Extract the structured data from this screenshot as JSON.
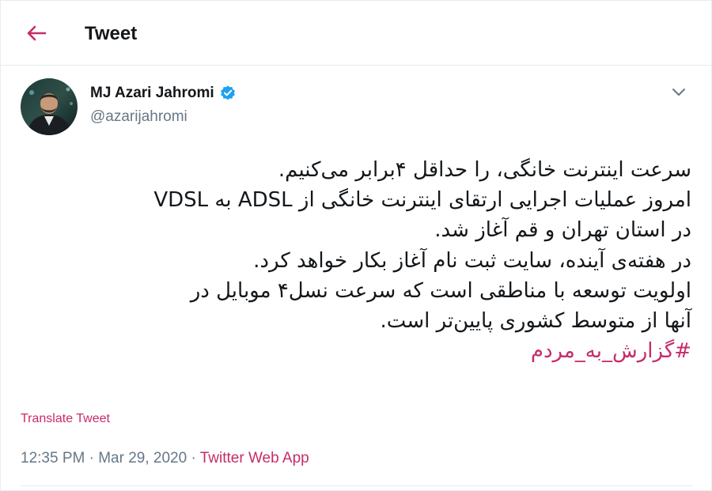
{
  "header": {
    "back_icon": "arrow-left-icon",
    "title": "Tweet"
  },
  "tweet": {
    "author": {
      "name": "MJ Azari Jahromi",
      "handle": "@azarijahromi",
      "verified": true,
      "verified_icon": "verified-badge-icon"
    },
    "menu_icon": "chevron-down-icon",
    "lines": [
      "سرعت اینترنت خانگی، را حداقل ۴برابر می‌کنیم.",
      "امروز عملیات اجرایی ارتقای اینترنت خانگی از ADSL به VDSL",
      " در استان تهران و قم آغاز شد.",
      "در هفته‌ی آینده، سایت ثبت نام آغاز بکار خواهد کرد.",
      "اولویت توسعه با مناطقی است که سرعت نسل۴ موبایل در",
      "آنها از متوسط کشوری پایین‌تر است."
    ],
    "hashtag": "#گزارش_به_مردم",
    "translate_label": "Translate Tweet",
    "time": "12:35 PM",
    "separator": "·",
    "date": "Mar 29, 2020",
    "source": "Twitter Web App"
  },
  "colors": {
    "accent": "#c62c6a",
    "verified": "#1da1f2",
    "muted": "#657786",
    "text": "#14171a"
  }
}
